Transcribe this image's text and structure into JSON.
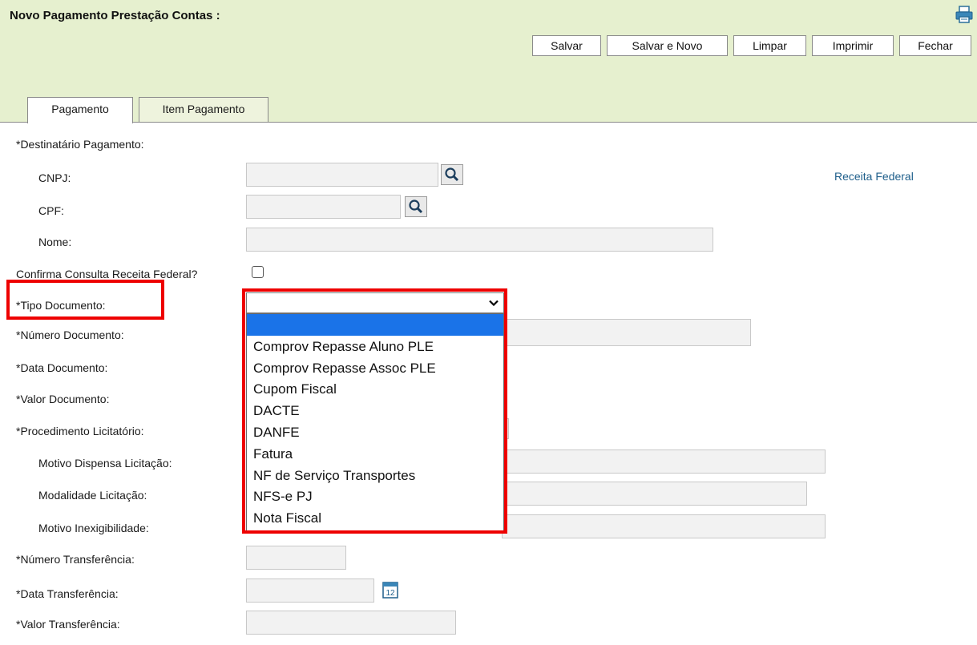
{
  "header": {
    "title": "Novo Pagamento Prestação Contas :",
    "print_icon": "printer-icon"
  },
  "toolbar": {
    "salvar": "Salvar",
    "salvar_novo": "Salvar e Novo",
    "limpar": "Limpar",
    "imprimir": "Imprimir",
    "fechar": "Fechar"
  },
  "tabs": [
    {
      "label": "Pagamento",
      "active": true
    },
    {
      "label": "Item Pagamento",
      "active": false
    }
  ],
  "form": {
    "destinatario": "*Destinatário Pagamento:",
    "cnpj": "CNPJ:",
    "cpf": "CPF:",
    "nome": "Nome:",
    "receita_link": "Receita Federal",
    "confirma": "Confirma Consulta Receita Federal?",
    "tipo_documento": "*Tipo Documento:",
    "numero_documento": "*Número Documento:",
    "data_documento": "*Data Documento:",
    "valor_documento": "*Valor Documento:",
    "procedimento": "*Procedimento Licitatório:",
    "motivo_dispensa": "Motivo Dispensa Licitação:",
    "modalidade": "Modalidade Licitação:",
    "motivo_inexig": "Motivo Inexigibilidade:",
    "numero_transferencia": "*Número Transferência:",
    "data_transferencia": "*Data Transferência:",
    "valor_transferencia": "*Valor Transferência:"
  },
  "tipo_documento_select": {
    "selected": "",
    "options": [
      "",
      "Comprov Repasse Aluno PLE",
      "Comprov Repasse Assoc PLE",
      "Cupom Fiscal",
      "DACTE",
      "DANFE",
      "Fatura",
      "NF de Serviço Transportes",
      "NFS-e PJ",
      "Nota Fiscal"
    ]
  },
  "colors": {
    "header_bg": "#e6f0cf",
    "highlight": "#ee0000",
    "link": "#1f5f8b",
    "selected_option": "#1a73e8"
  },
  "icons": {
    "search": "magnifier-icon",
    "calendar": "calendar-icon",
    "dropdown": "chevron-down-icon"
  }
}
